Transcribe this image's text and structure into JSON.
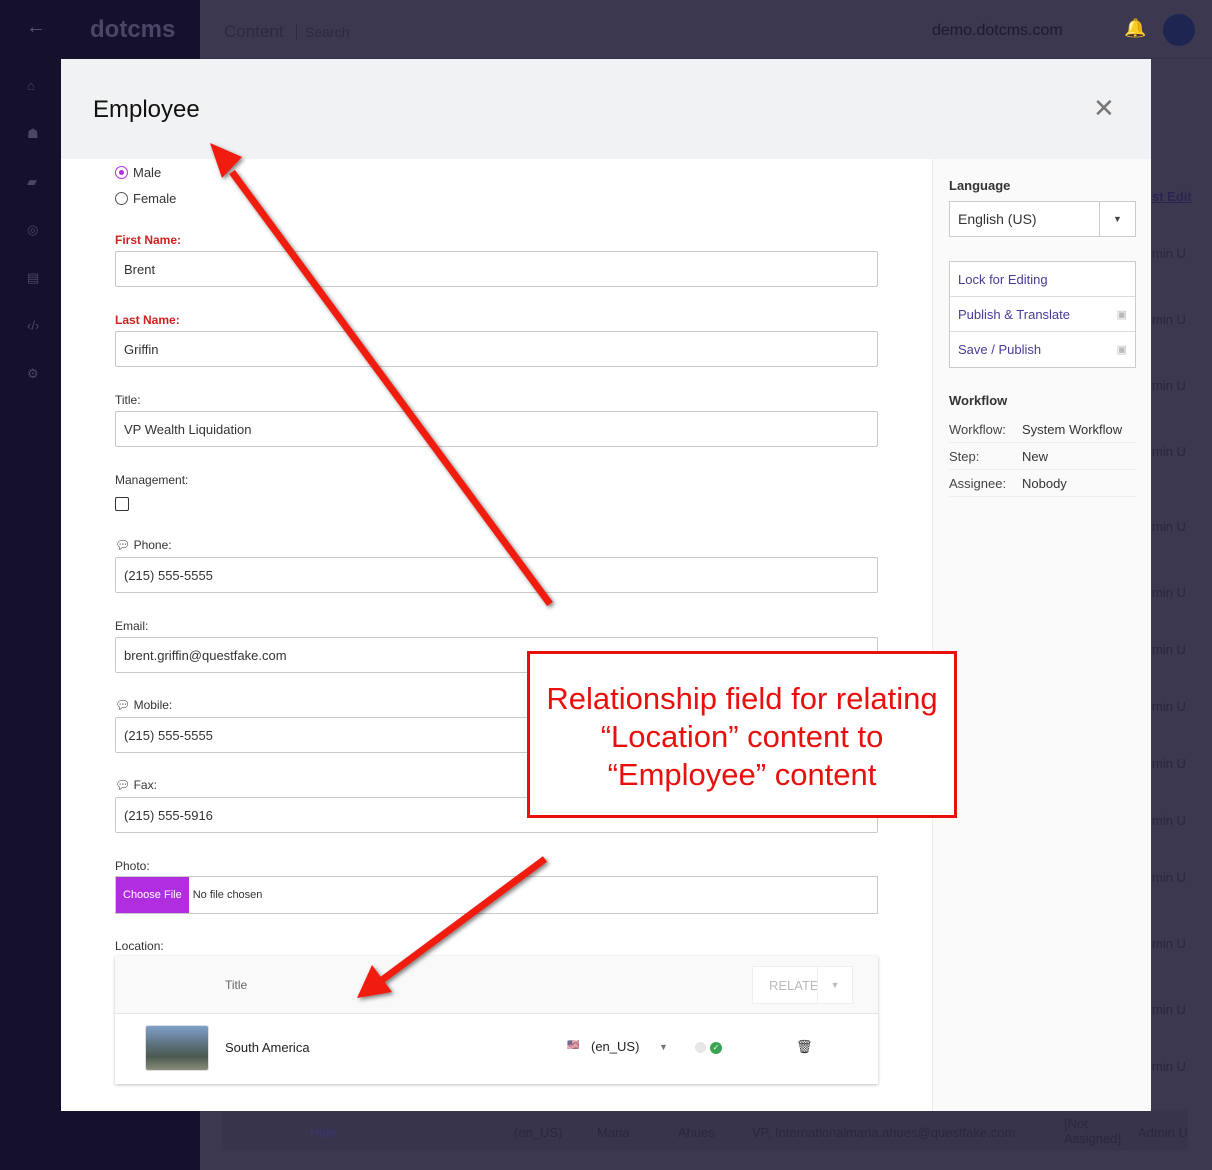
{
  "app": {
    "logo": "dotcms",
    "breadcrumb": [
      "Content",
      "Search"
    ],
    "site": "demo.dotcms.com"
  },
  "background": {
    "col_header": "st Edit",
    "cell": "min U",
    "row": {
      "hide": "Hide",
      "lang": "(en_US)",
      "first": "Maria",
      "last": "Ahues",
      "title": "VP, International",
      "email": "maria.ahues@questfake.com",
      "assigned": "[Not Assigned]",
      "user": "Admin U"
    }
  },
  "modal": {
    "title": "Employee",
    "form": {
      "gender": {
        "options": [
          "Male",
          "Female"
        ],
        "selected": "Male"
      },
      "first_name": {
        "label": "First Name:",
        "value": "Brent"
      },
      "last_name": {
        "label": "Last Name:",
        "value": "Griffin"
      },
      "title": {
        "label": "Title:",
        "value": "VP Wealth Liquidation"
      },
      "management": {
        "label": "Management:",
        "checked": false
      },
      "phone": {
        "label": "Phone:",
        "value": "(215) 555-5555"
      },
      "email": {
        "label": "Email:",
        "value": "brent.griffin@questfake.com"
      },
      "mobile": {
        "label": "Mobile:",
        "value": "(215) 555-5555"
      },
      "fax": {
        "label": "Fax:",
        "value": "(215) 555-5916"
      },
      "photo": {
        "label": "Photo:",
        "button": "Choose File",
        "status": "No file chosen"
      },
      "location": {
        "label": "Location:",
        "column": "Title",
        "relate_button": "RELATE",
        "rows": [
          {
            "title": "South America",
            "lang": "(en_US)"
          }
        ]
      }
    },
    "sidebar": {
      "language_label": "Language",
      "language": "English (US)",
      "actions": [
        "Lock for Editing",
        "Publish & Translate",
        "Save / Publish"
      ],
      "workflow_label": "Workflow",
      "workflow": [
        {
          "k": "Workflow:",
          "v": "System Workflow"
        },
        {
          "k": "Step:",
          "v": "New"
        },
        {
          "k": "Assignee:",
          "v": "Nobody"
        }
      ]
    }
  },
  "annotation": {
    "text": "Relationship field for relating “Location” content to “Employee” content",
    "color": "#e8100c"
  }
}
